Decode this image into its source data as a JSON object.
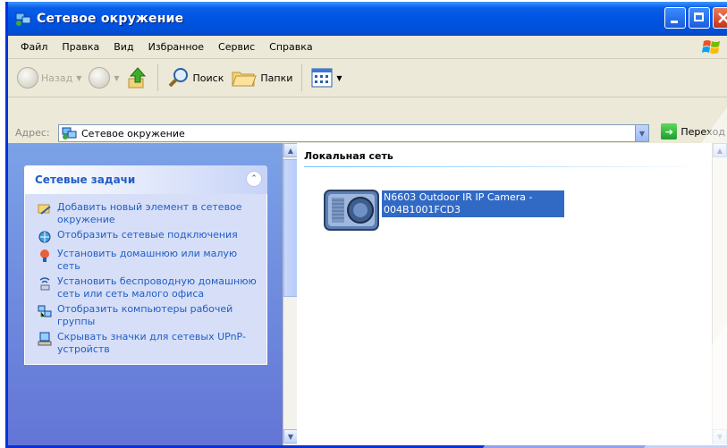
{
  "window": {
    "title": "Сетевое окружение"
  },
  "menu": {
    "items": [
      "Файл",
      "Правка",
      "Вид",
      "Избранное",
      "Сервис",
      "Справка"
    ]
  },
  "toolbar": {
    "back_label": "Назад",
    "search_label": "Поиск",
    "folders_label": "Папки"
  },
  "address": {
    "label": "Адрес:",
    "value": "Сетевое окружение",
    "go_label": "Переход"
  },
  "tasks": {
    "header": "Сетевые задачи",
    "items": [
      {
        "label": "Добавить новый элемент в сетевое окружение",
        "icon": "add-network-place-icon"
      },
      {
        "label": "Отобразить сетевые подключения",
        "icon": "network-connections-icon"
      },
      {
        "label": "Установить домашнюю или малую сеть",
        "icon": "home-network-icon"
      },
      {
        "label": "Установить беспроводную домашнюю сеть или сеть малого офиса",
        "icon": "wireless-network-icon"
      },
      {
        "label": "Отобразить компьютеры рабочей группы",
        "icon": "workgroup-computers-icon"
      },
      {
        "label": "Скрывать значки для сетевых UPnP-устройств",
        "icon": "upnp-devices-icon"
      }
    ]
  },
  "content": {
    "group_header": "Локальная сеть",
    "device_label": "N6603 Outdoor IR IP Camera - 004B1001FCD3"
  },
  "colors": {
    "titlebar": "#0054e3",
    "selection": "#316ac5",
    "task_link": "#215dc6",
    "task_pane": "#6375d6"
  }
}
